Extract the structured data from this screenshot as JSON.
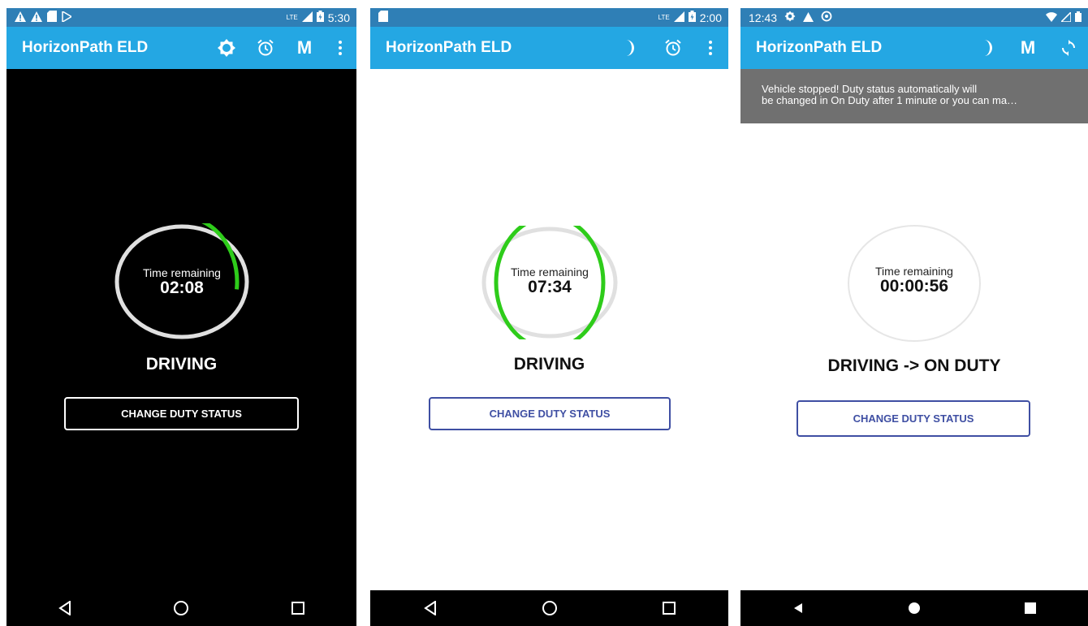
{
  "screens": [
    {
      "theme": "dark",
      "status_bar": {
        "left_icons": [
          "warning-icon",
          "warning-icon",
          "sd-card-icon",
          "play-store-icon"
        ],
        "network": "LTE",
        "time": "5:30"
      },
      "app_bar": {
        "title": "HorizonPath ELD",
        "actions": [
          "brightness-icon",
          "alarm-icon",
          "M",
          "overflow-menu-icon"
        ]
      },
      "timer": {
        "label": "Time remaining",
        "value": "02:08",
        "progress": 0.27
      },
      "duty_status": "DRIVING",
      "button_label": "CHANGE DUTY STATUS",
      "colors": {
        "background": "#000000",
        "ring_track": "#e0e0e0",
        "ring_fill": "#2ecc1a",
        "button_border": "#ffffff"
      }
    },
    {
      "theme": "light",
      "status_bar": {
        "left_icons": [
          "sd-card-icon"
        ],
        "network": "LTE",
        "time": "2:00"
      },
      "app_bar": {
        "title": "HorizonPath ELD",
        "actions": [
          "moon-icon",
          "alarm-icon",
          "overflow-menu-icon"
        ]
      },
      "timer": {
        "label": "Time remaining",
        "value": "07:34",
        "progress": 0.94
      },
      "duty_status": "DRIVING",
      "button_label": "CHANGE DUTY STATUS",
      "colors": {
        "background": "#ffffff",
        "ring_track": "#e0e0e0",
        "ring_fill": "#2ecc1a",
        "button_border": "#3f4fa3"
      }
    },
    {
      "theme": "light",
      "status_bar": {
        "time": "12:43",
        "left_icons": [
          "settings-icon",
          "warning-icon",
          "sync-icon"
        ],
        "right_icons": [
          "wifi-icon",
          "signal-icon",
          "battery-icon"
        ]
      },
      "app_bar": {
        "title": "HorizonPath ELD",
        "actions": [
          "moon-icon",
          "M",
          "refresh-icon"
        ]
      },
      "banner": {
        "line1": "Vehicle stopped! Duty status automatically will",
        "line2": "be changed in On Duty after 1 minute or you can ma…"
      },
      "timer": {
        "label": "Time remaining",
        "value": "00:00:56",
        "progress": 0
      },
      "duty_status": "DRIVING -> ON DUTY",
      "button_label": "CHANGE DUTY STATUS",
      "colors": {
        "background": "#ffffff",
        "ring_track": "#e6e6e6",
        "ring_fill": "#2ecc1a",
        "button_border": "#3f4fa3"
      }
    }
  ]
}
